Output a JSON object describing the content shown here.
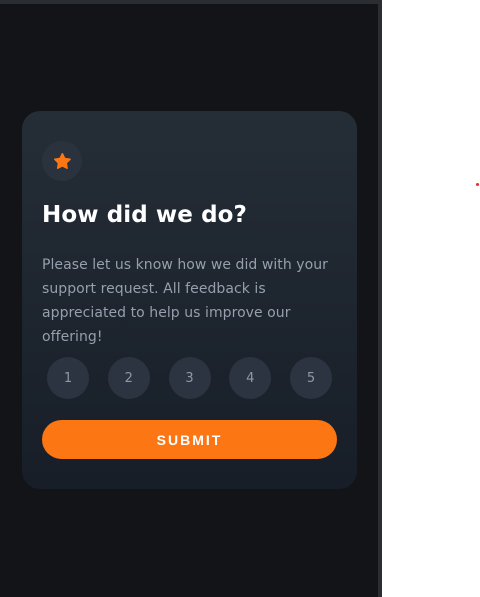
{
  "card": {
    "title": "How did we do?",
    "description": "Please let us know how we did with your support request. All feedback is appreciated to help us improve our offering!",
    "icon": "star-icon",
    "ratings": [
      "1",
      "2",
      "3",
      "4",
      "5"
    ],
    "submit_label": "SUBMIT"
  },
  "colors": {
    "page_background": "#121417",
    "card_background": "#252d37",
    "accent": "#fc7614",
    "rating_button": "#2b3440",
    "text_muted": "#969fad"
  }
}
